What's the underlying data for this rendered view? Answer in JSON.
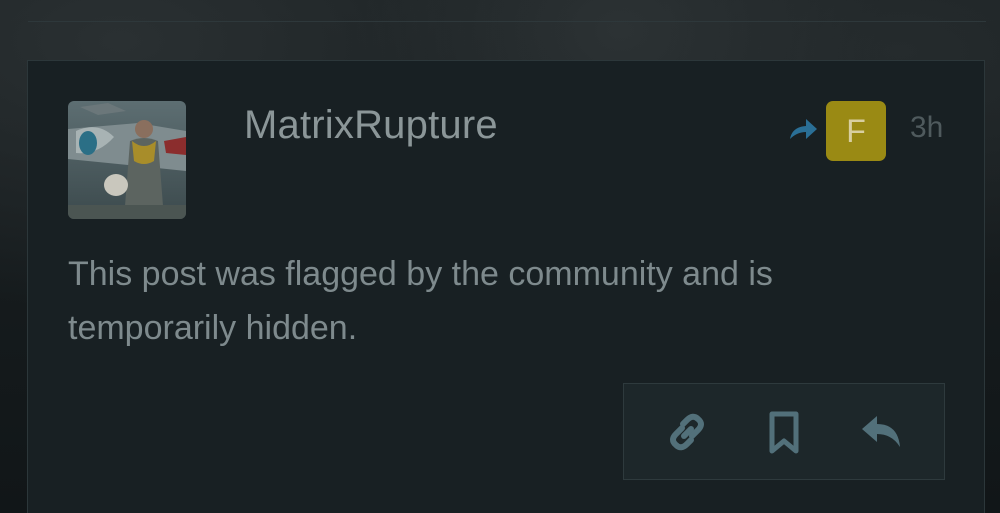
{
  "post": {
    "username": "MatrixRupture",
    "flair_letter": "F",
    "time": "3h",
    "body": "This post was flagged by the community and is temporarily hidden."
  },
  "icons": {
    "avatar": "pilot-avatar-image",
    "reply_indicator": "reply-arrow-icon",
    "actions": [
      "link-icon",
      "bookmark-icon",
      "reply-icon"
    ]
  },
  "colors": {
    "accent_blue": "#2a6f96",
    "flair_gold": "#9a8a14",
    "icon_slate": "#52707a"
  }
}
